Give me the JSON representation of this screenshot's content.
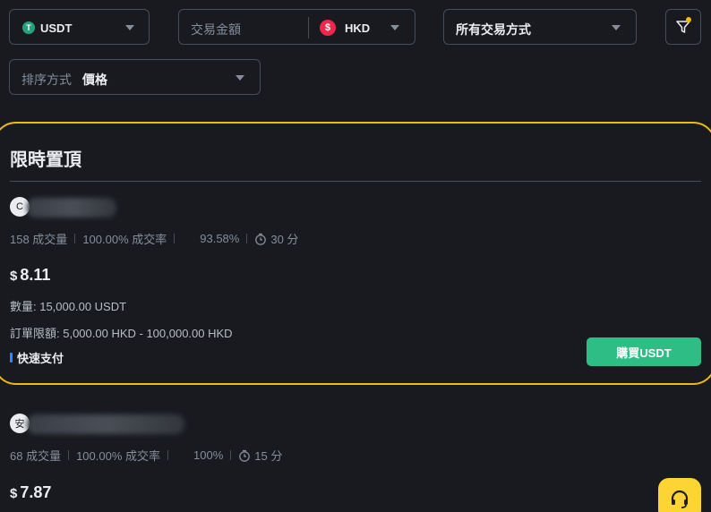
{
  "filters": {
    "coin": {
      "label": "USDT",
      "icon": "tether-icon",
      "icon_glyph": "T"
    },
    "amount": {
      "placeholder": "交易金額",
      "currency": "HKD",
      "currency_icon_glyph": "$"
    },
    "payment": {
      "label": "所有交易方式"
    },
    "sort": {
      "label": "排序方式",
      "value": "價格"
    }
  },
  "promoted": {
    "title": "限時置頂",
    "ad": {
      "avatar_initial": "C",
      "orders": "158 成交量",
      "completion": "100.00% 成交率",
      "rating": "93.58%",
      "pay_time": "30 分",
      "currency_symbol": "$",
      "price": "8.11",
      "quantity": "數量: 15,000.00 USDT",
      "limits": "訂單限額: 5,000.00 HKD - 100,000.00 HKD",
      "payment_method": "快速支付",
      "buy_label": "購買USDT"
    }
  },
  "next_ad": {
    "avatar_initial": "安",
    "orders": "68 成交量",
    "completion": "100.00% 成交率",
    "rating": "100%",
    "pay_time": "15 分",
    "currency_symbol": "$",
    "price": "7.87"
  },
  "colors": {
    "background": "#181a20",
    "promo_border": "#f0b90b",
    "buy_button": "#2ebd85",
    "support_button": "#fcd535"
  }
}
